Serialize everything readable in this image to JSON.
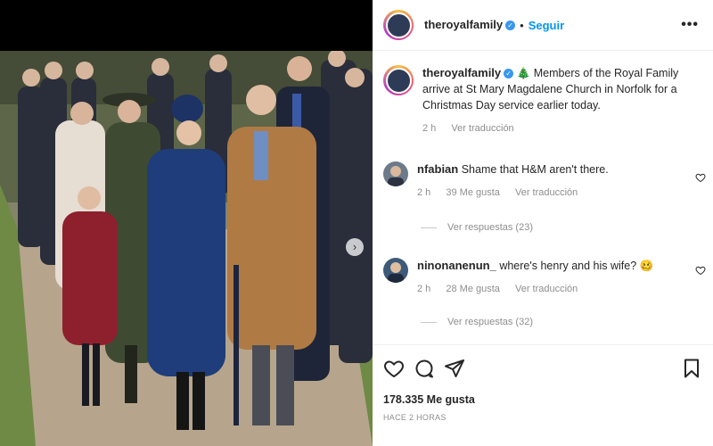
{
  "post": {
    "username": "theroyalfamily",
    "follow_label": "Seguir",
    "more_label": "•••",
    "caption_emoji": "🎄",
    "caption_text": "Members of the Royal Family arrive at St Mary Magdalene Church in Norfolk for a Christmas Day service earlier today.",
    "caption_time": "2 h",
    "caption_translate": "Ver traducción",
    "likes": "178.335 Me gusta",
    "posted_ago": "HACE 2 HORAS"
  },
  "comments": [
    {
      "username": "nfabian",
      "text": "Shame that H&M aren't there.",
      "time": "2 h",
      "likes": "39 Me gusta",
      "translate": "Ver traducción",
      "replies": "Ver respuestas (23)"
    },
    {
      "username": "ninonanenun_",
      "text": "where's henry and his wife? 🥴",
      "time": "2 h",
      "likes": "28 Me gusta",
      "translate": "Ver traducción",
      "replies": "Ver respuestas (32)"
    }
  ],
  "media": {
    "next_arrow": "›"
  },
  "icons": {
    "like": "heart-icon",
    "comment": "comment-icon",
    "share": "share-icon",
    "save": "bookmark-icon",
    "verified": "verified-badge-icon"
  },
  "colors": {
    "follow": "#0095f6",
    "verified": "#3897f0",
    "muted": "#8e8e8e"
  }
}
